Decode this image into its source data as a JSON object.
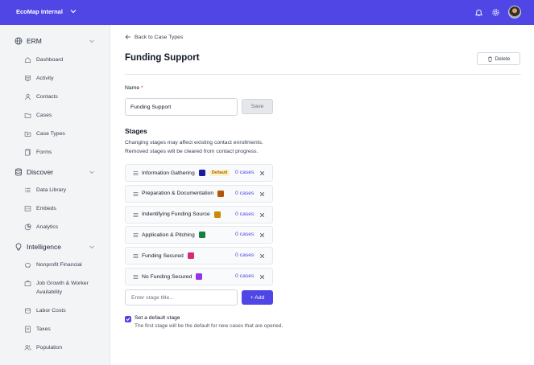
{
  "topbar": {
    "org_name": "EcoMap Internal",
    "icons": [
      "bell-icon",
      "gear-icon",
      "avatar"
    ]
  },
  "sidebar": {
    "sections": [
      {
        "title": "ERM",
        "icon": "globe-icon",
        "items": [
          {
            "label": "Dashboard",
            "icon": "home-icon"
          },
          {
            "label": "Activity",
            "icon": "activity-icon"
          },
          {
            "label": "Contacts",
            "icon": "user-icon"
          },
          {
            "label": "Cases",
            "icon": "folder-icon"
          },
          {
            "label": "Case Types",
            "icon": "folder-plus-icon"
          },
          {
            "label": "Forms",
            "icon": "document-icon"
          }
        ]
      },
      {
        "title": "Discover",
        "icon": "database-icon",
        "items": [
          {
            "label": "Data Library",
            "icon": "list-icon"
          },
          {
            "label": "Embeds",
            "icon": "embed-icon"
          },
          {
            "label": "Analytics",
            "icon": "chart-icon"
          }
        ]
      },
      {
        "title": "Intelligence",
        "icon": "lightbulb-icon",
        "items": [
          {
            "label": "Nonprofit Financial",
            "icon": "piggy-bank-icon"
          },
          {
            "label": "Job Growth & Worker Availability",
            "icon": "briefcase-icon"
          },
          {
            "label": "Labor Costs",
            "icon": "coins-icon"
          },
          {
            "label": "Taxes",
            "icon": "receipt-icon"
          },
          {
            "label": "Population",
            "icon": "users-icon"
          }
        ]
      }
    ]
  },
  "main": {
    "back_label": "Back to Case Types",
    "title": "Funding Support",
    "delete_label": "Delete",
    "name_label": "Name",
    "required_mark": "*",
    "name_value": "Funding Support",
    "save_label": "Save",
    "stages_heading": "Stages",
    "stages_desc_1": "Changing stages may affect existing contact enrollments.",
    "stages_desc_2": "Removed stages will be cleared from contact progress.",
    "stages": [
      {
        "name": "Information Gathering",
        "color": "#1e1b9e",
        "badge": "Default",
        "cases": "0 cases"
      },
      {
        "name": "Preparation & Documentation",
        "color": "#b45309",
        "badge": "",
        "cases": "0 cases"
      },
      {
        "name": "Indentifying Funding Source",
        "color": "#ca8a04",
        "badge": "",
        "cases": "0 cases"
      },
      {
        "name": "Application & Pitching",
        "color": "#15803d",
        "badge": "",
        "cases": "0 cases"
      },
      {
        "name": "Funding Secured",
        "color": "#db2777",
        "badge": "",
        "cases": "0 cases"
      },
      {
        "name": "No Funding Secured",
        "color": "#9333ea",
        "badge": "",
        "cases": "0 cases"
      }
    ],
    "new_stage_placeholder": "Enter stage title...",
    "add_label": "+ Add",
    "default_stage_checked": true,
    "default_stage_label": "Set a default stage",
    "default_stage_help": "The first stage will be the default for new cases that are opened."
  },
  "colors": {
    "accent": "#4f46e5",
    "sidebar_bg": "#f3f4f6"
  }
}
